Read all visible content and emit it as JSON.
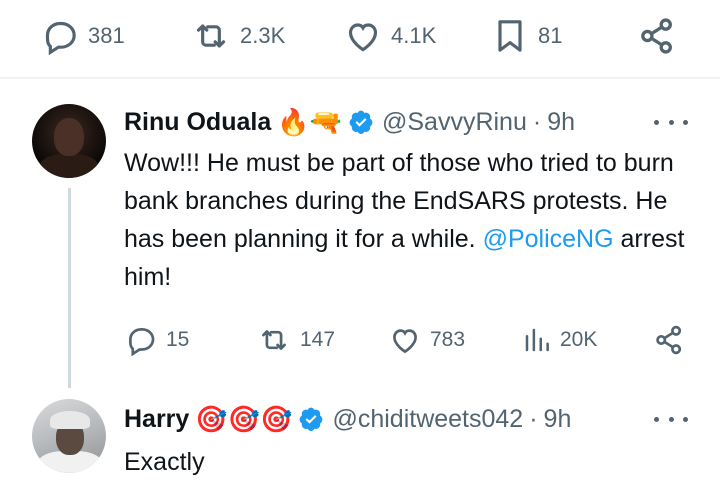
{
  "colors": {
    "accent": "#1d9bf0",
    "muted": "#536471",
    "text": "#0f1419",
    "thread_line": "#cfd9de"
  },
  "top_actions": {
    "replies": {
      "icon": "reply-bubble-icon",
      "count": "381"
    },
    "reposts": {
      "icon": "repost-icon",
      "count": "2.3K"
    },
    "likes": {
      "icon": "heart-icon",
      "count": "4.1K"
    },
    "bookmarks": {
      "icon": "bookmark-icon",
      "count": "81"
    },
    "share": {
      "icon": "share-icon"
    }
  },
  "tweet": {
    "author_name": "Rinu Oduala",
    "author_emoji": "🔥🔫",
    "handle": "@SavvyRinu",
    "separator": "·",
    "time": "9h",
    "text_before": "Wow!!! He must be part of those who tried to burn bank branches during the EndSARS protests. He has been planning it for a while.",
    "mention": "@PoliceNG",
    "text_after": "arrest him!",
    "actions": {
      "replies": "15",
      "reposts": "147",
      "likes": "783",
      "views": "20K"
    }
  },
  "reply": {
    "author_name": "Harry",
    "author_emoji": "🎯🎯🎯",
    "handle": "@chiditweets042",
    "separator": "·",
    "time": "9h",
    "text": "Exactly"
  }
}
